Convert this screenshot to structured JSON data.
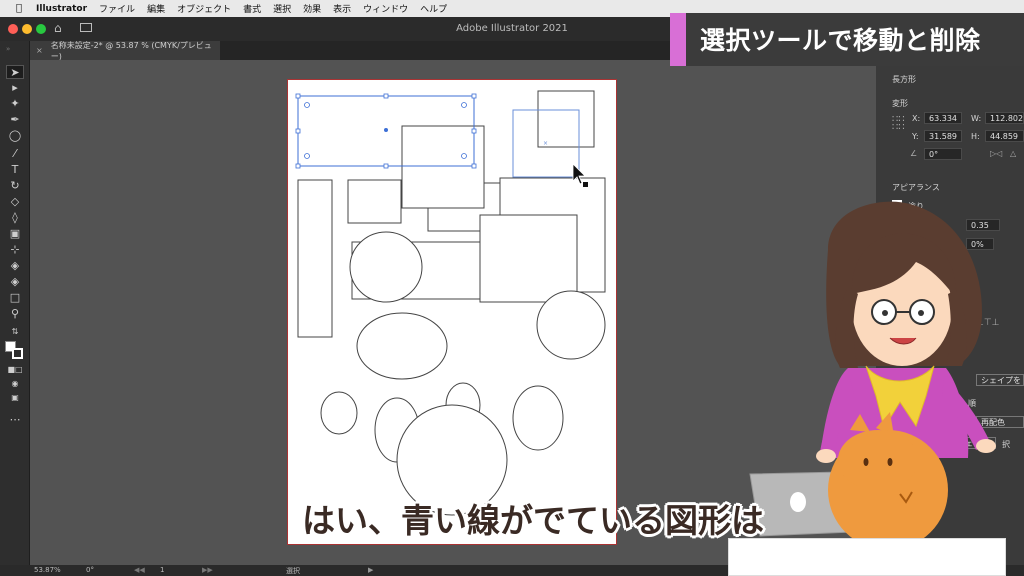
{
  "menubar": {
    "app": "Illustrator",
    "items": [
      "ファイル",
      "編集",
      "オブジェクト",
      "書式",
      "選択",
      "効果",
      "表示",
      "ウィンドウ",
      "ヘルプ"
    ]
  },
  "window": {
    "title": "Adobe Illustrator 2021",
    "doc_tab": "名称未設定-2* @ 53.87 % (CMYK/プレビュー)"
  },
  "banner": {
    "text": "選択ツールで移動と削除"
  },
  "subtitle": {
    "text": "はい、青い線がでている図形は"
  },
  "properties": {
    "object_type": "長方形",
    "transform_heading": "変形",
    "x_label": "X:",
    "x_value": "63.334",
    "y_label": "Y:",
    "y_value": "31.589",
    "w_label": "W:",
    "w_value": "112.802",
    "h_label": "H:",
    "h_value": "44.859",
    "angle_value": "0°",
    "appearance_heading": "アピアランス",
    "fill_label": "塗り",
    "stroke_value": "0.35",
    "opacity_value": "0%",
    "shape_button": "シェイプを",
    "recolor_button": "再配色",
    "order_label": "順",
    "object_button": "ジェクトを",
    "select_label": "択"
  },
  "status": {
    "zoom": "53.87%",
    "angle": "0°",
    "page": "1",
    "tool": "選択"
  },
  "colors": {
    "accent_pink": "#d86fd6",
    "selection_blue": "#3d6fd6",
    "artboard_red": "#a33333"
  }
}
